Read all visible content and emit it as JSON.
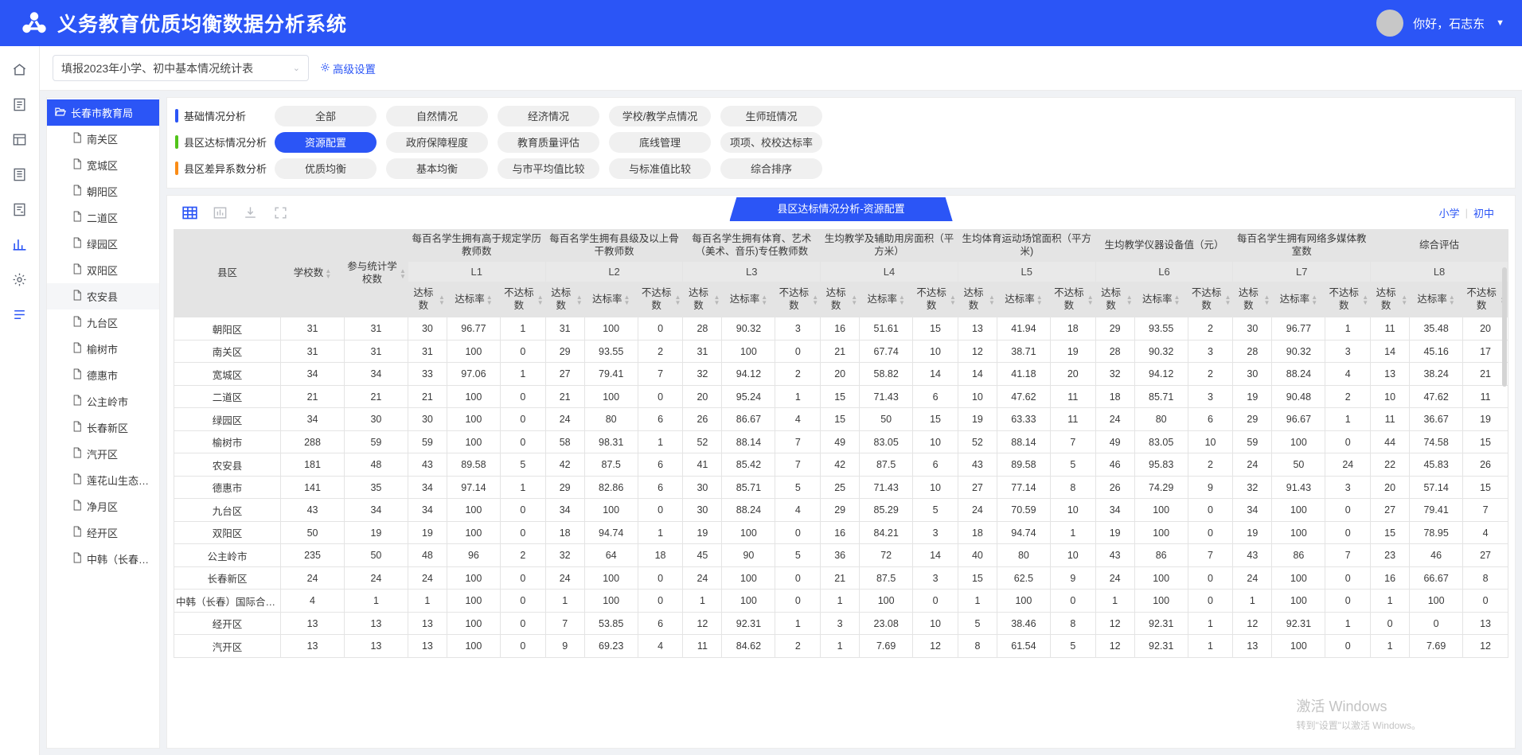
{
  "header": {
    "title": "义务教育优质均衡数据分析系统",
    "logo_icon": "network-nodes-icon",
    "greeting": "你好，石志东",
    "caret_icon": "caret-down-icon",
    "brand_color": "#2b55f6"
  },
  "rail": {
    "items": [
      {
        "icon": "home-icon",
        "active": false
      },
      {
        "icon": "form-icon",
        "active": false
      },
      {
        "icon": "table-icon",
        "active": false
      },
      {
        "icon": "document-icon",
        "active": false
      },
      {
        "icon": "report-icon",
        "active": false
      },
      {
        "icon": "chart-icon",
        "active": true
      },
      {
        "icon": "gear-icon",
        "active": false
      },
      {
        "icon": "list-icon",
        "active": true
      }
    ]
  },
  "filterbar": {
    "select_value": "填报2023年小学、初中基本情况统计表",
    "select_chevron": "chevron-down-icon",
    "advanced_icon": "gear-icon",
    "advanced_label": "高级设置"
  },
  "tree": {
    "root": {
      "label": "长春市教育局",
      "icon": "folder-open-icon"
    },
    "children": [
      {
        "label": "南关区",
        "icon": "file-icon",
        "selected": false
      },
      {
        "label": "宽城区",
        "icon": "file-icon",
        "selected": false
      },
      {
        "label": "朝阳区",
        "icon": "file-icon",
        "selected": false
      },
      {
        "label": "二道区",
        "icon": "file-icon",
        "selected": false
      },
      {
        "label": "绿园区",
        "icon": "file-icon",
        "selected": false
      },
      {
        "label": "双阳区",
        "icon": "file-icon",
        "selected": false
      },
      {
        "label": "农安县",
        "icon": "file-icon",
        "selected": true
      },
      {
        "label": "九台区",
        "icon": "file-icon",
        "selected": false
      },
      {
        "label": "榆树市",
        "icon": "file-icon",
        "selected": false
      },
      {
        "label": "德惠市",
        "icon": "file-icon",
        "selected": false
      },
      {
        "label": "公主岭市",
        "icon": "file-icon",
        "selected": false
      },
      {
        "label": "长春新区",
        "icon": "file-icon",
        "selected": false
      },
      {
        "label": "汽开区",
        "icon": "file-icon",
        "selected": false
      },
      {
        "label": "莲花山生态…",
        "icon": "file-icon",
        "selected": false
      },
      {
        "label": "净月区",
        "icon": "file-icon",
        "selected": false
      },
      {
        "label": "经开区",
        "icon": "file-icon",
        "selected": false
      },
      {
        "label": "中韩（长春…",
        "icon": "file-icon",
        "selected": false
      }
    ]
  },
  "categories": [
    {
      "label": "基础情况分析",
      "bullet_color": "#2b55f6",
      "chips": [
        {
          "label": "全部",
          "active": false
        },
        {
          "label": "自然情况",
          "active": false
        },
        {
          "label": "经济情况",
          "active": false
        },
        {
          "label": "学校/教学点情况",
          "active": false
        },
        {
          "label": "生师班情况",
          "active": false
        }
      ]
    },
    {
      "label": "县区达标情况分析",
      "bullet_color": "#52c41a",
      "chips": [
        {
          "label": "资源配置",
          "active": true
        },
        {
          "label": "政府保障程度",
          "active": false
        },
        {
          "label": "教育质量评估",
          "active": false
        },
        {
          "label": "底线管理",
          "active": false
        },
        {
          "label": "项项、校校达标率",
          "active": false
        }
      ]
    },
    {
      "label": "县区差异系数分析",
      "bullet_color": "#fa8c16",
      "chips": [
        {
          "label": "优质均衡",
          "active": false
        },
        {
          "label": "基本均衡",
          "active": false
        },
        {
          "label": "与市平均值比较",
          "active": false
        },
        {
          "label": "与标准值比较",
          "active": false
        },
        {
          "label": "综合排序",
          "active": false
        }
      ]
    }
  ],
  "table_toolbar": {
    "icons": [
      {
        "name": "table-view-icon",
        "active": true
      },
      {
        "name": "bar-chart-icon",
        "active": false
      },
      {
        "name": "download-icon",
        "active": false
      },
      {
        "name": "fullscreen-icon",
        "active": false
      }
    ],
    "ribbon_title": "县区达标情况分析-资源配置",
    "level_primary": "小学",
    "level_divider": "|",
    "level_junior": "初中"
  },
  "watermark": {
    "line1": "激活 Windows",
    "line2": "转到\"设置\"以激活 Windows。"
  },
  "table": {
    "fixed_headers": [
      {
        "label": "县区",
        "sortable": false
      },
      {
        "label": "学校数",
        "sortable": true
      },
      {
        "label": "参与统计学校数",
        "sortable": true
      }
    ],
    "groups": [
      {
        "title": "每百名学生拥有高于规定学历教师数",
        "code": "L1"
      },
      {
        "title": "每百名学生拥有县级及以上骨干教师数",
        "code": "L2"
      },
      {
        "title": "每百名学生拥有体育、艺术（美术、音乐)专任教师数",
        "code": "L3"
      },
      {
        "title": "生均教学及辅助用房面积（平方米）",
        "code": "L4"
      },
      {
        "title": "生均体育运动场馆面积（平方米)",
        "code": "L5"
      },
      {
        "title": "生均教学仪器设备值（元）",
        "code": "L6"
      },
      {
        "title": "每百名学生拥有网络多媒体教室数",
        "code": "L7"
      },
      {
        "title": "综合评估",
        "code": "L8"
      }
    ],
    "sub_headers": [
      "达标数",
      "达标率",
      "不达标数"
    ],
    "rows": [
      {
        "name": "朝阳区",
        "schools": "31",
        "counted": "31",
        "cells": [
          "30",
          "96.77",
          "1",
          "31",
          "100",
          "0",
          "28",
          "90.32",
          "3",
          "16",
          "51.61",
          "15",
          "13",
          "41.94",
          "18",
          "29",
          "93.55",
          "2",
          "30",
          "96.77",
          "1",
          "11",
          "35.48",
          "20"
        ]
      },
      {
        "name": "南关区",
        "schools": "31",
        "counted": "31",
        "cells": [
          "31",
          "100",
          "0",
          "29",
          "93.55",
          "2",
          "31",
          "100",
          "0",
          "21",
          "67.74",
          "10",
          "12",
          "38.71",
          "19",
          "28",
          "90.32",
          "3",
          "28",
          "90.32",
          "3",
          "14",
          "45.16",
          "17"
        ]
      },
      {
        "name": "宽城区",
        "schools": "34",
        "counted": "34",
        "cells": [
          "33",
          "97.06",
          "1",
          "27",
          "79.41",
          "7",
          "32",
          "94.12",
          "2",
          "20",
          "58.82",
          "14",
          "14",
          "41.18",
          "20",
          "32",
          "94.12",
          "2",
          "30",
          "88.24",
          "4",
          "13",
          "38.24",
          "21"
        ]
      },
      {
        "name": "二道区",
        "schools": "21",
        "counted": "21",
        "cells": [
          "21",
          "100",
          "0",
          "21",
          "100",
          "0",
          "20",
          "95.24",
          "1",
          "15",
          "71.43",
          "6",
          "10",
          "47.62",
          "11",
          "18",
          "85.71",
          "3",
          "19",
          "90.48",
          "2",
          "10",
          "47.62",
          "11"
        ]
      },
      {
        "name": "绿园区",
        "schools": "34",
        "counted": "30",
        "cells": [
          "30",
          "100",
          "0",
          "24",
          "80",
          "6",
          "26",
          "86.67",
          "4",
          "15",
          "50",
          "15",
          "19",
          "63.33",
          "11",
          "24",
          "80",
          "6",
          "29",
          "96.67",
          "1",
          "11",
          "36.67",
          "19"
        ]
      },
      {
        "name": "榆树市",
        "schools": "288",
        "counted": "59",
        "cells": [
          "59",
          "100",
          "0",
          "58",
          "98.31",
          "1",
          "52",
          "88.14",
          "7",
          "49",
          "83.05",
          "10",
          "52",
          "88.14",
          "7",
          "49",
          "83.05",
          "10",
          "59",
          "100",
          "0",
          "44",
          "74.58",
          "15"
        ]
      },
      {
        "name": "农安县",
        "schools": "181",
        "counted": "48",
        "cells": [
          "43",
          "89.58",
          "5",
          "42",
          "87.5",
          "6",
          "41",
          "85.42",
          "7",
          "42",
          "87.5",
          "6",
          "43",
          "89.58",
          "5",
          "46",
          "95.83",
          "2",
          "24",
          "50",
          "24",
          "22",
          "45.83",
          "26"
        ]
      },
      {
        "name": "德惠市",
        "schools": "141",
        "counted": "35",
        "cells": [
          "34",
          "97.14",
          "1",
          "29",
          "82.86",
          "6",
          "30",
          "85.71",
          "5",
          "25",
          "71.43",
          "10",
          "27",
          "77.14",
          "8",
          "26",
          "74.29",
          "9",
          "32",
          "91.43",
          "3",
          "20",
          "57.14",
          "15"
        ]
      },
      {
        "name": "九台区",
        "schools": "43",
        "counted": "34",
        "cells": [
          "34",
          "100",
          "0",
          "34",
          "100",
          "0",
          "30",
          "88.24",
          "4",
          "29",
          "85.29",
          "5",
          "24",
          "70.59",
          "10",
          "34",
          "100",
          "0",
          "34",
          "100",
          "0",
          "27",
          "79.41",
          "7"
        ]
      },
      {
        "name": "双阳区",
        "schools": "50",
        "counted": "19",
        "cells": [
          "19",
          "100",
          "0",
          "18",
          "94.74",
          "1",
          "19",
          "100",
          "0",
          "16",
          "84.21",
          "3",
          "18",
          "94.74",
          "1",
          "19",
          "100",
          "0",
          "19",
          "100",
          "0",
          "15",
          "78.95",
          "4"
        ]
      },
      {
        "name": "公主岭市",
        "schools": "235",
        "counted": "50",
        "cells": [
          "48",
          "96",
          "2",
          "32",
          "64",
          "18",
          "45",
          "90",
          "5",
          "36",
          "72",
          "14",
          "40",
          "80",
          "10",
          "43",
          "86",
          "7",
          "43",
          "86",
          "7",
          "23",
          "46",
          "27"
        ]
      },
      {
        "name": "长春新区",
        "schools": "24",
        "counted": "24",
        "cells": [
          "24",
          "100",
          "0",
          "24",
          "100",
          "0",
          "24",
          "100",
          "0",
          "21",
          "87.5",
          "3",
          "15",
          "62.5",
          "9",
          "24",
          "100",
          "0",
          "24",
          "100",
          "0",
          "16",
          "66.67",
          "8"
        ]
      },
      {
        "name": "中韩（长春）国际合作…",
        "schools": "4",
        "counted": "1",
        "cells": [
          "1",
          "100",
          "0",
          "1",
          "100",
          "0",
          "1",
          "100",
          "0",
          "1",
          "100",
          "0",
          "1",
          "100",
          "0",
          "1",
          "100",
          "0",
          "1",
          "100",
          "0",
          "1",
          "100",
          "0"
        ]
      },
      {
        "name": "经开区",
        "schools": "13",
        "counted": "13",
        "cells": [
          "13",
          "100",
          "0",
          "7",
          "53.85",
          "6",
          "12",
          "92.31",
          "1",
          "3",
          "23.08",
          "10",
          "5",
          "38.46",
          "8",
          "12",
          "92.31",
          "1",
          "12",
          "92.31",
          "1",
          "0",
          "0",
          "13"
        ]
      },
      {
        "name": "汽开区",
        "schools": "13",
        "counted": "13",
        "cells": [
          "13",
          "100",
          "0",
          "9",
          "69.23",
          "4",
          "11",
          "84.62",
          "2",
          "1",
          "7.69",
          "12",
          "8",
          "61.54",
          "5",
          "12",
          "92.31",
          "1",
          "13",
          "100",
          "0",
          "1",
          "7.69",
          "12"
        ]
      }
    ]
  }
}
